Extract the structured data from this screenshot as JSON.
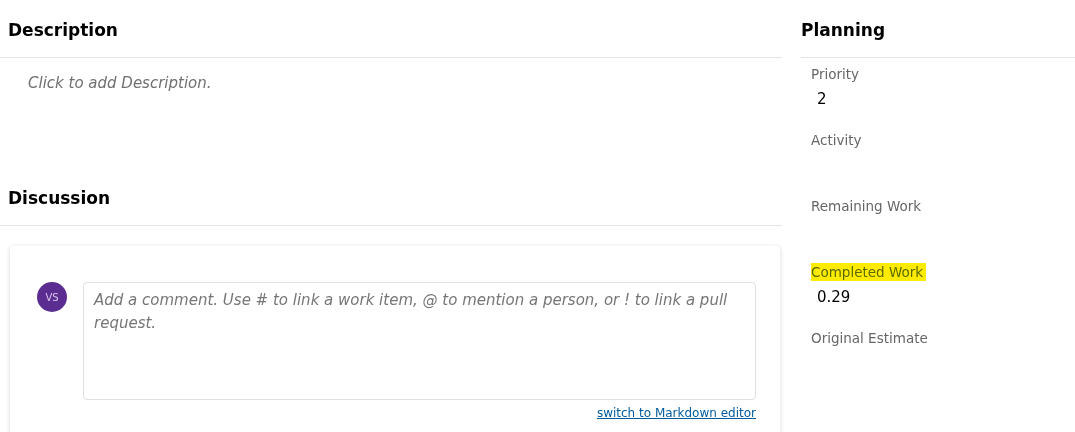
{
  "description": {
    "title": "Description",
    "placeholder": "Click to add Description."
  },
  "discussion": {
    "title": "Discussion",
    "avatar": "VS",
    "comment_placeholder": "Add a comment. Use # to link a work item, @ to mention a person, or ! to link a pull request.",
    "editor_link": "switch to Markdown editor"
  },
  "planning": {
    "title": "Planning",
    "fields": [
      {
        "label": "Priority",
        "value": "2",
        "highlighted": false
      },
      {
        "label": "Activity",
        "highlighted": false
      },
      {
        "label": "Remaining Work",
        "highlighted": false
      },
      {
        "label": "Completed Work",
        "value": "0.29",
        "highlighted": true
      },
      {
        "label": "Original Estimate",
        "highlighted": false
      }
    ]
  }
}
